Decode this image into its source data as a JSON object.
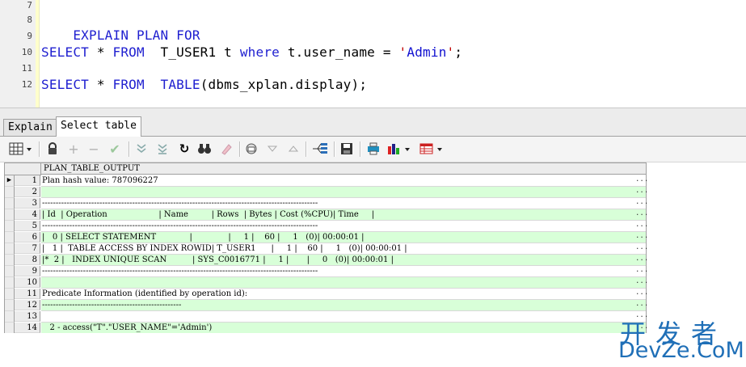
{
  "editor": {
    "line_numbers": [
      "7",
      "8",
      "9",
      "10",
      "11",
      "12"
    ],
    "line8": {
      "kw": "EXPLAIN PLAN FOR"
    },
    "line10": {
      "kw1": "SELECT",
      "op1": " * ",
      "kw2": "FROM",
      "tbl": "  T_USER1 t ",
      "kw3": "where",
      "mid": " t.user_name = ",
      "q1": "'",
      "str": "Admin",
      "q2": "'",
      "end": ";"
    },
    "line12": {
      "kw1": "SELECT",
      "op1": " * ",
      "kw2": "FROM",
      "sp": "  ",
      "kw3": "TABLE",
      "rest": "(dbms_xplan.display);"
    }
  },
  "tabs": [
    "Explain",
    "Select table"
  ],
  "toolbar": {
    "icons": [
      "grid-menu-icon",
      "lock-icon",
      "add-record-icon",
      "delete-record-icon",
      "post-changes-icon",
      "fetch-next-icon",
      "fetch-last-icon",
      "refresh-icon",
      "find-icon",
      "clear-icon",
      "query-by-example-icon",
      "sort-asc-icon",
      "sort-desc-icon",
      "export-icon",
      "save-icon",
      "print-icon",
      "chart-icon",
      "table-view-icon"
    ]
  },
  "grid": {
    "column": "PLAN_TABLE_OUTPUT",
    "rows": [
      {
        "n": "1",
        "text": "Plan hash value: 787096227"
      },
      {
        "n": "2",
        "text": ""
      },
      {
        "n": "3",
        "text": "-----------------------------------------------------------------------------------------------------"
      },
      {
        "n": "4",
        "text": "| Id  | Operation                    | Name         | Rows  | Bytes | Cost (%CPU)| Time     |"
      },
      {
        "n": "5",
        "text": "-----------------------------------------------------------------------------------------------------"
      },
      {
        "n": "6",
        "text": "|   0 | SELECT STATEMENT             |              |     1 |    60 |     1   (0)| 00:00:01 |"
      },
      {
        "n": "7",
        "text": "|   1 |  TABLE ACCESS BY INDEX ROWID| T_USER1      |     1 |    60 |     1   (0)| 00:00:01 |"
      },
      {
        "n": "8",
        "text": "|*  2 |   INDEX UNIQUE SCAN          | SYS_C0016771 |     1 |       |     0   (0)| 00:00:01 |"
      },
      {
        "n": "9",
        "text": "-----------------------------------------------------------------------------------------------------"
      },
      {
        "n": "10",
        "text": ""
      },
      {
        "n": "11",
        "text": "Predicate Information (identified by operation id):"
      },
      {
        "n": "12",
        "text": "---------------------------------------------------"
      },
      {
        "n": "13",
        "text": ""
      },
      {
        "n": "14",
        "text": "   2 - access(\"T\".\"USER_NAME\"='Admin')"
      }
    ],
    "ellipsis": "..."
  },
  "watermark": {
    "cn": "开发者",
    "en": "DevZe.CoM"
  }
}
